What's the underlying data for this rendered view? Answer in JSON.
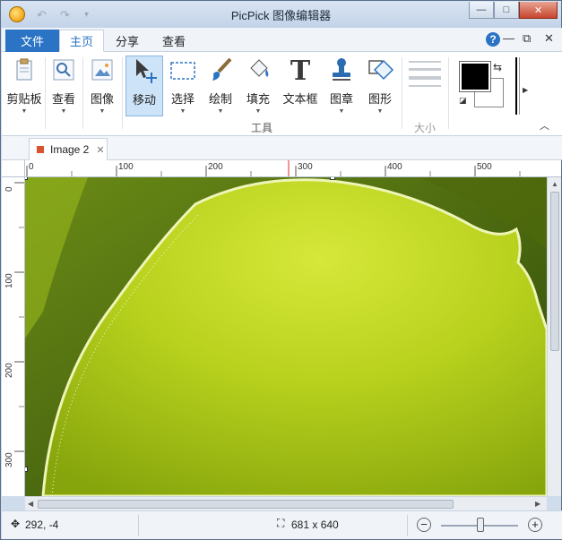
{
  "window": {
    "title": "PicPick 图像编辑器",
    "controls": {
      "minimize": "—",
      "maximize": "□",
      "close": "✕"
    }
  },
  "ribbon_tabs": {
    "file": "文件",
    "tabs": [
      {
        "label": "主页",
        "active": true
      },
      {
        "label": "分享",
        "active": false
      },
      {
        "label": "查看",
        "active": false
      }
    ],
    "help": "?",
    "minimize": "—",
    "restore": "⧉",
    "close": "✕"
  },
  "ribbon": {
    "buttons": {
      "clipboard": "剪贴板",
      "view": "查看",
      "image": "图像",
      "move": "移动",
      "select": "选择",
      "draw": "绘制",
      "fill": "填充",
      "textbox": "文本框",
      "stamp": "图章",
      "shape": "图形"
    },
    "group_tools": "工具",
    "group_size": "大小",
    "colors": {
      "primary": "#000000",
      "secondary": "#ffffff"
    }
  },
  "document_tabs": [
    {
      "label": "Image 2",
      "close": "✕"
    }
  ],
  "ruler": {
    "h_labels": [
      "0",
      "100",
      "200",
      "300",
      "400",
      "500"
    ],
    "v_labels": [
      "0",
      "100",
      "200",
      "300"
    ]
  },
  "status": {
    "cursor_pos": "292, -4",
    "image_size": "681 x 640",
    "zoom_out": "−",
    "zoom_in": "+"
  },
  "theme": {
    "accent": "#2b73c4",
    "file_tab": "#2b73c4",
    "doc_dot": "#d9532c"
  }
}
